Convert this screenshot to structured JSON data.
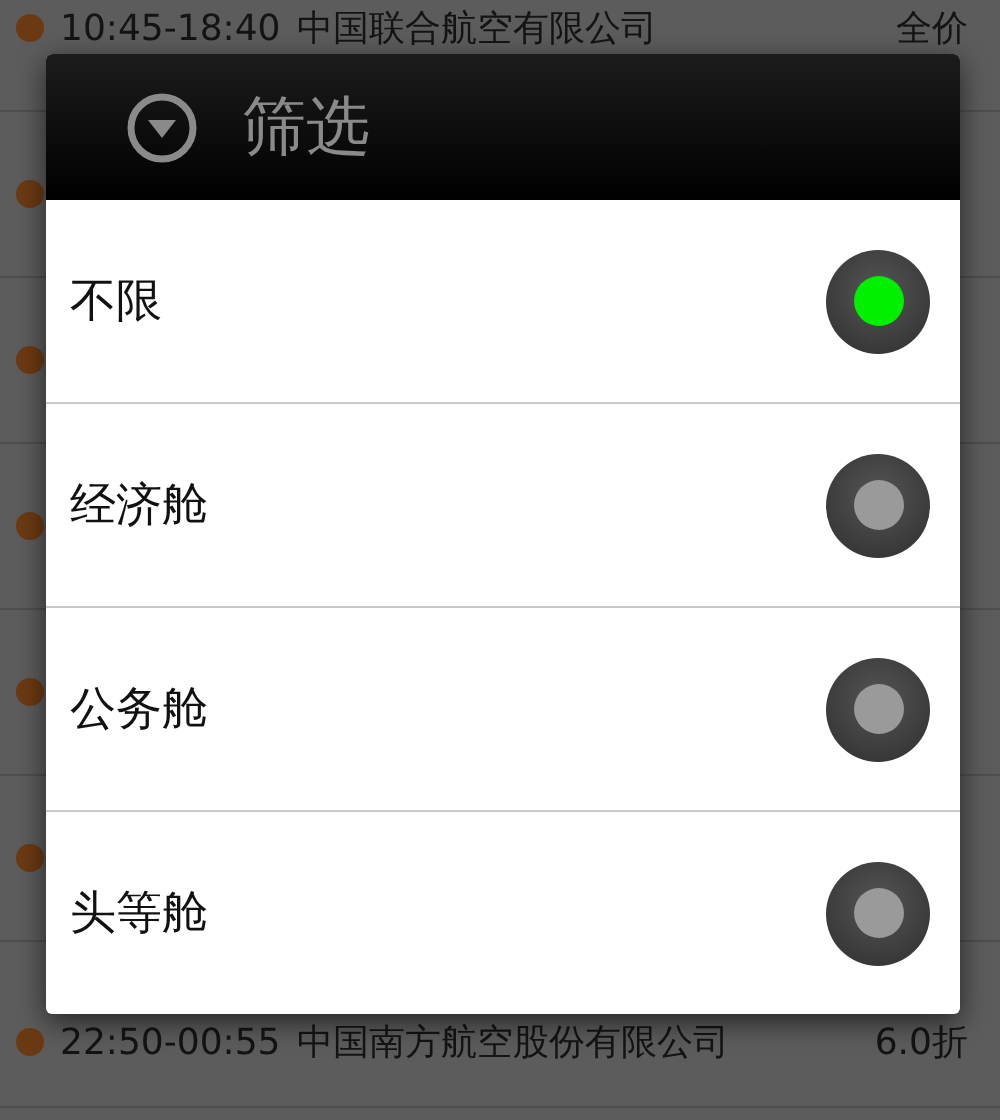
{
  "flights": [
    {
      "time": "10:45-18:40",
      "airline": "中国联合航空有限公司",
      "price": "全价"
    },
    {
      "time": "22:50-00:55",
      "airline": "中国南方航空股份有限公司",
      "price": "6.0折"
    }
  ],
  "dialog": {
    "title": "筛选",
    "options": [
      {
        "label": "不限",
        "selected": true
      },
      {
        "label": "经济舱",
        "selected": false
      },
      {
        "label": "公务舱",
        "selected": false
      },
      {
        "label": "头等舱",
        "selected": false
      }
    ]
  }
}
